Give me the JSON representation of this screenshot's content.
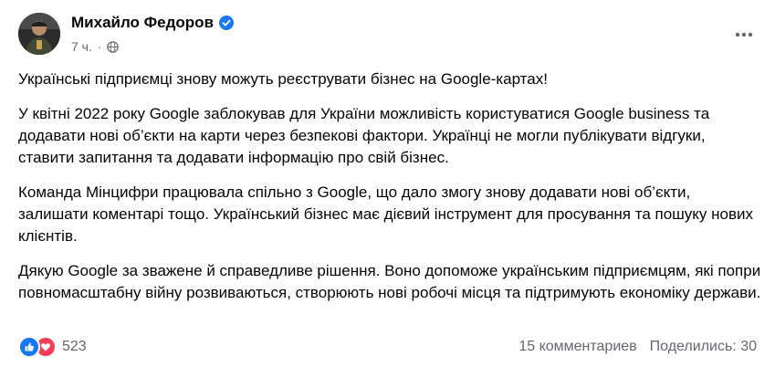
{
  "post": {
    "author": "Михайло Федоров",
    "time": "7 ч.",
    "separator": "·",
    "icons": {
      "verified": "verified-badge-icon",
      "privacy": "globe-icon",
      "more": "more-options-icon"
    },
    "paragraphs": [
      "Українські підприємці знову можуть реєструвати бізнес на Google-картах!",
      "У квітні 2022 року Google заблокував для України можливість користуватися Google business та додавати нові об’єкти на карти через безпекові фактори. Українці не могли публікувати відгуки, ставити запитання та додавати інформацію про свій бізнес.",
      "Команда Мінцифри працювала спільно з Google, що дало змогу знову додавати нові об’єкти, залишати коментарі тощо. Український бізнес має дієвий інструмент для просування та пошуку нових клієнтів.",
      "Дякую Google за зважене й справедливе рішення. Воно допоможе українським підприємцям, які попри повномасштабну війну розвиваються, створюють нові робочі місця та підтримують економіку держави."
    ]
  },
  "footer": {
    "reaction_count": "523",
    "comments": "15 комментариев",
    "shares": "Поделились: 30"
  },
  "colors": {
    "like": "#1877f2",
    "love": "#f33e58",
    "verified": "#1877f2",
    "secondary_text": "#65676b"
  }
}
